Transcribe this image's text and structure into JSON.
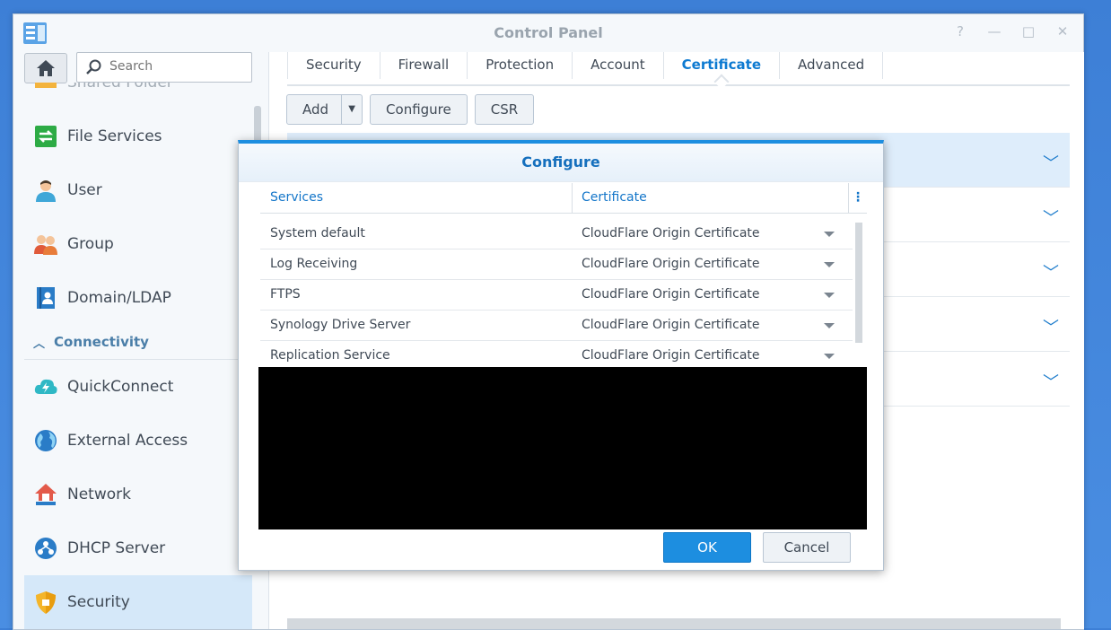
{
  "window": {
    "title": "Control Panel",
    "controls": {
      "help": "?",
      "minimize": "—",
      "maximize": "□",
      "close": "✕"
    }
  },
  "search": {
    "placeholder": "Search"
  },
  "sidebar": {
    "items": [
      {
        "label": "Shared Folder",
        "icon": "folder-icon"
      },
      {
        "label": "File Services",
        "icon": "file-services-icon"
      },
      {
        "label": "User",
        "icon": "user-icon"
      },
      {
        "label": "Group",
        "icon": "group-icon"
      },
      {
        "label": "Domain/LDAP",
        "icon": "domain-icon"
      }
    ],
    "section": {
      "label": "Connectivity"
    },
    "items2": [
      {
        "label": "QuickConnect",
        "icon": "quickconnect-icon"
      },
      {
        "label": "External Access",
        "icon": "globe-icon"
      },
      {
        "label": "Network",
        "icon": "network-icon"
      },
      {
        "label": "DHCP Server",
        "icon": "dhcp-icon"
      },
      {
        "label": "Security",
        "icon": "shield-icon"
      }
    ]
  },
  "tabs": [
    {
      "label": "Security"
    },
    {
      "label": "Firewall"
    },
    {
      "label": "Protection"
    },
    {
      "label": "Account"
    },
    {
      "label": "Certificate",
      "active": true
    },
    {
      "label": "Advanced"
    }
  ],
  "toolbar": {
    "add": "Add",
    "configure": "Configure",
    "csr": "CSR"
  },
  "dialog": {
    "title": "Configure",
    "columns": {
      "services": "Services",
      "certificate": "Certificate"
    },
    "rows": [
      {
        "service": "System default",
        "certificate": "CloudFlare Origin Certificate"
      },
      {
        "service": "Log Receiving",
        "certificate": "CloudFlare Origin Certificate"
      },
      {
        "service": "FTPS",
        "certificate": "CloudFlare Origin Certificate"
      },
      {
        "service": "Synology Drive Server",
        "certificate": "CloudFlare Origin Certificate"
      },
      {
        "service": "Replication Service",
        "certificate": "CloudFlare Origin Certificate"
      }
    ],
    "ok": "OK",
    "cancel": "Cancel"
  },
  "colors": {
    "accent": "#1d8ee0",
    "selected": "#d5e8f9",
    "text": "#404a56"
  }
}
